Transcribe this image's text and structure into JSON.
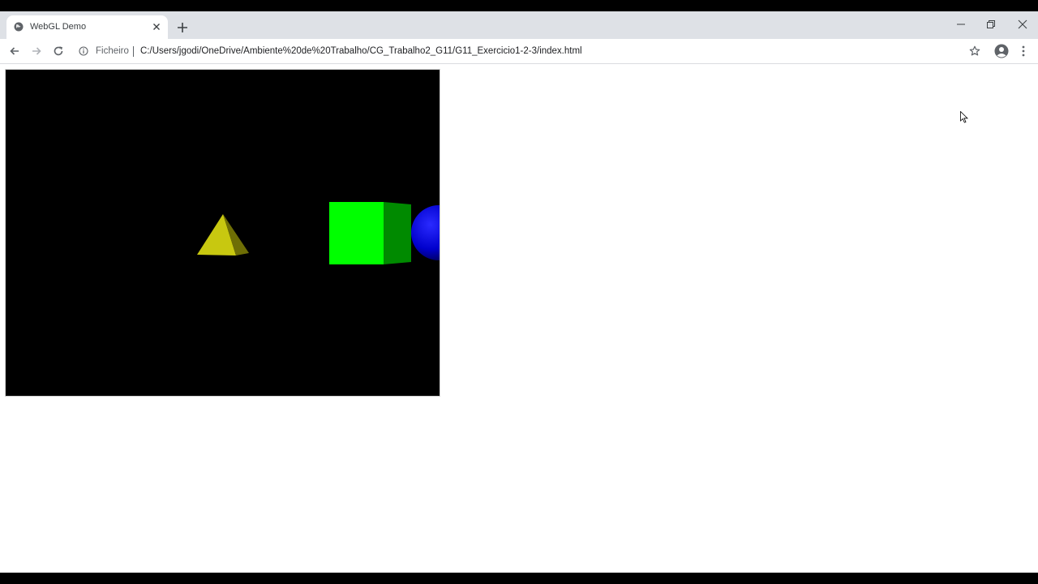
{
  "window": {
    "tab": {
      "title": "WebGL Demo",
      "favicon": "globe-icon"
    },
    "controls": [
      "minimize-icon",
      "restore-icon",
      "close-icon"
    ]
  },
  "toolbar": {
    "scheme_label": "Ficheiro",
    "url": "C:/Users/jgodi/OneDrive/Ambiente%20de%20Trabalho/CG_Trabalho2_G11/G11_Exercicio1-2-3/index.html"
  },
  "page": {
    "scene_objects": [
      "yellow-pyramid",
      "green-cube",
      "blue-sphere"
    ],
    "colors": {
      "background": "#000000",
      "pyramid": "#c8c810",
      "cube": "#00ff00",
      "sphere": "#0000ff"
    }
  }
}
